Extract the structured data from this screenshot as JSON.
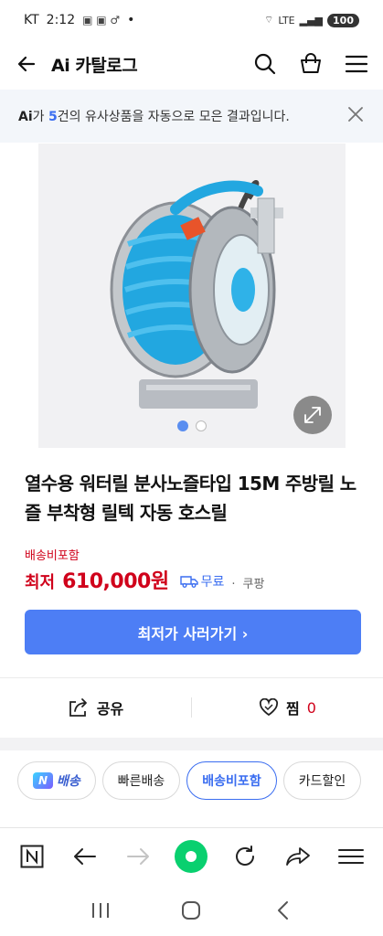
{
  "status_bar": {
    "carrier": "KT",
    "time": "2:12",
    "dot": "•",
    "battery": "100",
    "network": "LTE"
  },
  "header": {
    "title": "Ai 카탈로그"
  },
  "ai_notice": {
    "ai": "Ai",
    "prefix": "가 ",
    "count": "5",
    "suffix": "건의 유사상품을 자동으로 모은 결과입니다."
  },
  "gallery": {
    "current": 1,
    "total": 2
  },
  "product": {
    "title": "열수용 워터릴 분사노즐타입 15M 주방릴 노즐 부착형 릴텍 자동 호스릴",
    "shipping_note": "배송비포함",
    "price_label": "최저",
    "price": "610,000원",
    "free_shipping": "무료",
    "seller_sep": "·",
    "seller": "쿠팡"
  },
  "buy_button": "최저가 사러가기 ›",
  "actions": {
    "share": "공유",
    "like": "찜",
    "like_count": "0"
  },
  "filter_chips": [
    {
      "label": "배송",
      "badge": "N"
    },
    {
      "label": "빠른배송"
    },
    {
      "label": "배송비포함"
    },
    {
      "label": "카드할인"
    }
  ],
  "colors": {
    "accent": "#4d7ef5",
    "price": "#d0021b",
    "naver_green": "#09d06f"
  }
}
